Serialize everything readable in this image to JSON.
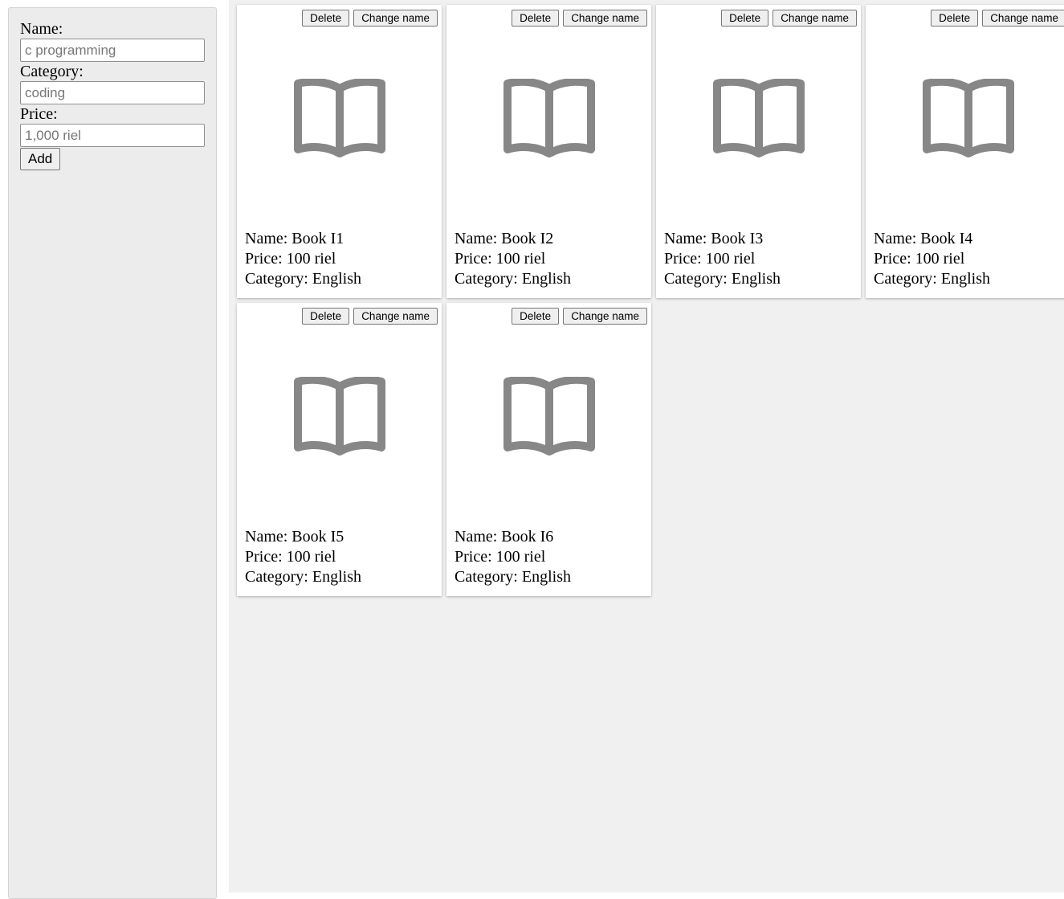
{
  "form": {
    "name_label": "Name:",
    "name_placeholder": "c programming",
    "category_label": "Category:",
    "category_placeholder": "coding",
    "price_label": "Price:",
    "price_placeholder": "1,000 riel",
    "add_label": "Add"
  },
  "card_actions": {
    "delete_label": "Delete",
    "change_name_label": "Change name"
  },
  "icons": {
    "book": "book-open-icon"
  },
  "colors": {
    "icon": "#878787",
    "main_bg": "#f0f0f0",
    "sidebar_bg": "#ececec"
  },
  "books": [
    {
      "name": "Name: Book I1",
      "price": "Price: 100 riel",
      "category": "Category: English"
    },
    {
      "name": "Name: Book I2",
      "price": "Price: 100 riel",
      "category": "Category: English"
    },
    {
      "name": "Name: Book I3",
      "price": "Price: 100 riel",
      "category": "Category: English"
    },
    {
      "name": "Name: Book I4",
      "price": "Price: 100 riel",
      "category": "Category: English"
    },
    {
      "name": "Name: Book I5",
      "price": "Price: 100 riel",
      "category": "Category: English"
    },
    {
      "name": "Name: Book I6",
      "price": "Price: 100 riel",
      "category": "Category: English"
    }
  ]
}
